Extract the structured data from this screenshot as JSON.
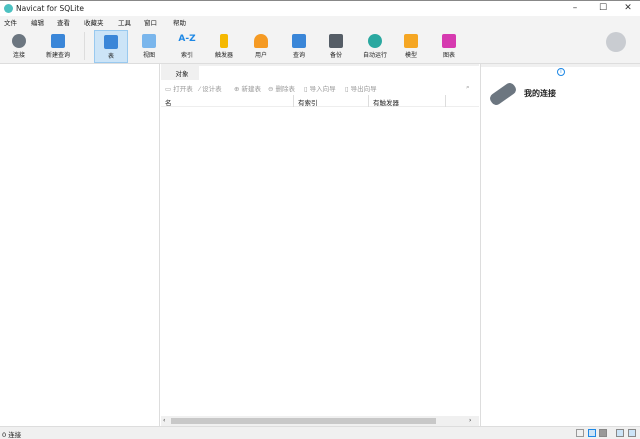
{
  "window": {
    "title": "Navicat for SQLite",
    "minimize": "–",
    "maximize": "☐",
    "close": "✕"
  },
  "menu": [
    "文件",
    "编辑",
    "查看",
    "收藏夹",
    "工具",
    "窗口",
    "帮助"
  ],
  "toolbar": [
    {
      "label": "连接",
      "color": "#6c7680"
    },
    {
      "label": "新建查询",
      "color": "#3a86d8"
    },
    {
      "label": "表",
      "color": "#3a86d8"
    },
    {
      "label": "视图",
      "color": "#3a86d8"
    },
    {
      "label": "索引",
      "color": "#1e88e5"
    },
    {
      "label": "触发器",
      "color": "#f5b800"
    },
    {
      "label": "用户",
      "color": "#f59a23"
    },
    {
      "label": "查询",
      "color": "#3a86d8"
    },
    {
      "label": "备份",
      "color": "#555d66"
    },
    {
      "label": "自动运行",
      "color": "#2aa8a0"
    },
    {
      "label": "模型",
      "color": "#f5a623"
    },
    {
      "label": "图表",
      "color": "#d63ab0"
    }
  ],
  "index_icon_text": "A-Z",
  "objects": {
    "tab": "对象",
    "actions": [
      "打开表",
      "设计表",
      "新建表",
      "删除表",
      "导入向导",
      "导出向导"
    ],
    "columns": [
      "名",
      "有索引",
      "有触发器"
    ]
  },
  "right": {
    "title": "我的连接",
    "info_icon": "i"
  },
  "status": {
    "text": "0 连接"
  }
}
